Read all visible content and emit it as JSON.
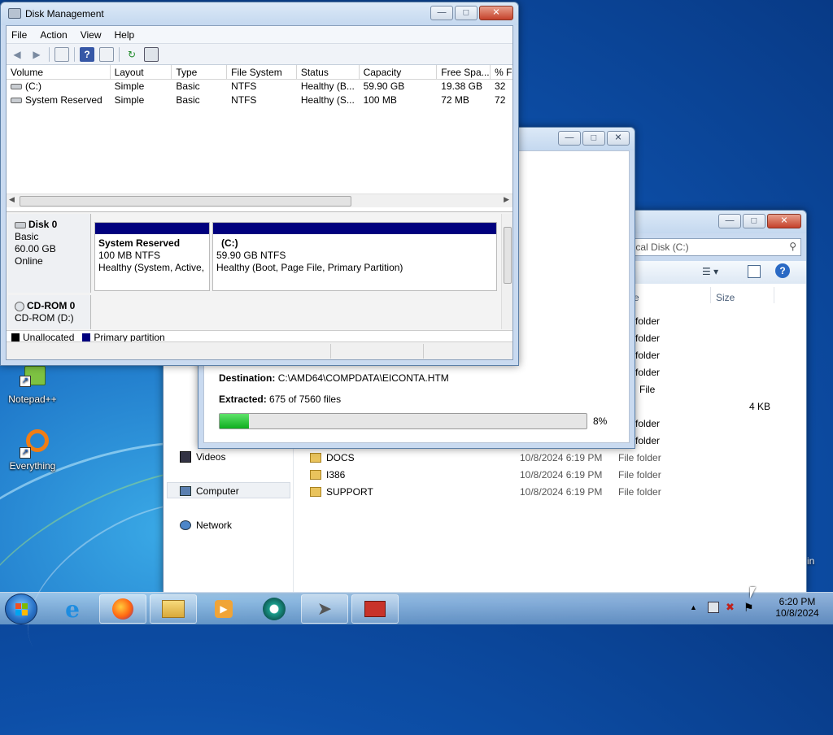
{
  "desktop": {
    "icons": [
      {
        "label": "Notepad++"
      },
      {
        "label": "Everything"
      }
    ],
    "edge_text": "in"
  },
  "disk_mgmt": {
    "title": "Disk Management",
    "menu": [
      "File",
      "Action",
      "View",
      "Help"
    ],
    "columns": [
      "Volume",
      "Layout",
      "Type",
      "File System",
      "Status",
      "Capacity",
      "Free Spa...",
      "% F"
    ],
    "rows": [
      [
        "(C:)",
        "Simple",
        "Basic",
        "NTFS",
        "Healthy (B...",
        "59.90 GB",
        "19.38 GB",
        "32"
      ],
      [
        "System Reserved",
        "Simple",
        "Basic",
        "NTFS",
        "Healthy (S...",
        "100 MB",
        "72 MB",
        "72"
      ]
    ],
    "disk0": {
      "name": "Disk 0",
      "type": "Basic",
      "size": "60.00 GB",
      "state": "Online",
      "partitions": [
        {
          "name": "System Reserved",
          "size": "100 MB NTFS",
          "status": "Healthy (System, Active,"
        },
        {
          "name": "(C:)",
          "size": "59.90 GB NTFS",
          "status": "Healthy (Boot, Page File, Primary Partition)"
        }
      ]
    },
    "cdrom0": {
      "name": "CD-ROM 0",
      "drive": "CD-ROM (D:)"
    },
    "legend": [
      {
        "label": "Unallocated",
        "color": "#000000"
      },
      {
        "label": "Primary partition",
        "color": "#00007e"
      }
    ]
  },
  "extract": {
    "destination_label": "Destination:",
    "destination_value": "C:\\AMD64\\COMPDATA\\EICONTA.HTM",
    "extracted_label": "Extracted:",
    "extracted_value": "675 of 7560 files",
    "percent": "8%",
    "progress": 0.08
  },
  "explorer": {
    "address": "Local Disk (C:)",
    "size_header": "Size",
    "name_header": "e",
    "nav": [
      "Videos",
      "Computer",
      "Network"
    ],
    "type_only_rows": [
      {
        "type": "folder",
        "size": ""
      },
      {
        "type": "folder",
        "size": ""
      },
      {
        "type": "folder",
        "size": ""
      },
      {
        "type": "folder",
        "size": ""
      },
      {
        "type": "File",
        "size": "4 KB"
      },
      {
        "type": "folder",
        "size": ""
      },
      {
        "type": "folder",
        "size": ""
      }
    ],
    "files": [
      {
        "name": "DOCS",
        "date": "10/8/2024 6:19 PM",
        "type": "File folder"
      },
      {
        "name": "I386",
        "date": "10/8/2024 6:19 PM",
        "type": "File folder"
      },
      {
        "name": "SUPPORT",
        "date": "10/8/2024 6:19 PM",
        "type": "File folder"
      }
    ]
  },
  "taskbar": {
    "time": "6:20 PM",
    "date": "10/8/2024"
  }
}
